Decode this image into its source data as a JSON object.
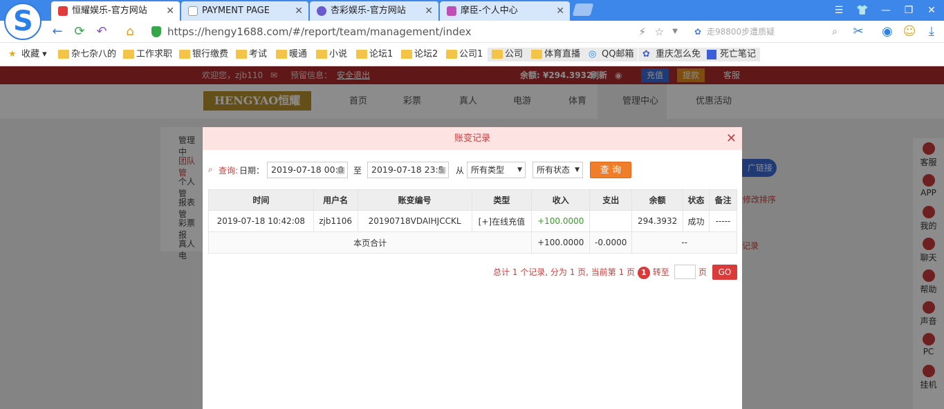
{
  "browser": {
    "tabs": [
      {
        "title": "恒耀娱乐-官方网站",
        "active": true
      },
      {
        "title": "PAYMENT PAGE",
        "active": false
      },
      {
        "title": "杏彩娱乐-官方网站",
        "active": false
      },
      {
        "title": "摩臣-个人中心",
        "active": false
      }
    ],
    "url": "https://hengy1688.com/#/report/team/management/index",
    "search_placeholder": "走98800步遭质疑",
    "bookmarks": [
      "收藏",
      "杂七杂八的",
      "工作求职",
      "银行缴费",
      "考试",
      "暖通",
      "小说",
      "论坛1",
      "论坛2",
      "公司1",
      "公司",
      "体育直播",
      "QQ邮箱",
      "重庆怎么免",
      "死亡笔记"
    ]
  },
  "site": {
    "welcome": "欢迎您，zjb110",
    "notice_label": "预留信息：",
    "logout": "安全退出",
    "balance": "余额: ¥294.3932",
    "refresh": "刷新",
    "recharge": "充值",
    "withdraw": "提款",
    "service": "客服",
    "brand": "HENGYAO恒耀",
    "nav": [
      "首页",
      "彩票",
      "真人",
      "电游",
      "体育",
      "管理中心",
      "优惠活动"
    ],
    "sidebar": [
      "管理中",
      "团队管",
      "个人管",
      "报表管",
      "彩票报",
      "真人电"
    ],
    "right_bar": [
      "客服",
      "APP",
      "我的",
      "聊天",
      "帮助",
      "声音",
      "PC",
      "挂机"
    ],
    "peek_link": "广链接",
    "peek_sort": "改修改排序",
    "peek_record": "记录"
  },
  "modal": {
    "title": "账变记录",
    "query_label": "查询:",
    "date_label": "日期：",
    "date_from": "2019-07-18 00:0",
    "to_label": "至",
    "date_to": "2019-07-18 23:5",
    "from_label": "从",
    "type_select": "所有类型",
    "status_select": "所有状态",
    "query_button": "查 询",
    "columns": [
      "时间",
      "用户名",
      "账变编号",
      "类型",
      "收入",
      "支出",
      "余额",
      "状态",
      "备注"
    ],
    "rows": [
      {
        "time": "2019-07-18 10:42:08",
        "user": "zjb1106",
        "id": "20190718VDAIHJCCKL",
        "type": "[+]在线充值",
        "income": "+100.0000",
        "expense": "",
        "balance": "294.3932",
        "status": "成功",
        "note": "-----"
      }
    ],
    "summary": {
      "label": "本页合计",
      "income": "+100.0000",
      "expense": "-0.0000",
      "rest": "--"
    },
    "pager": {
      "text": "总计 1 个记录, 分为 1 页, 当前第 1 页",
      "page": "1",
      "goto": "转至",
      "unit": "页",
      "go": "GO"
    }
  }
}
